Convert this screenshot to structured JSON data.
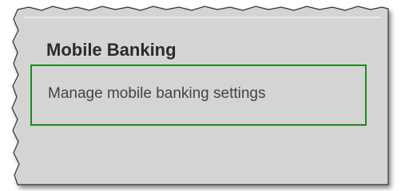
{
  "section": {
    "title": "Mobile Banking",
    "link_label": "Manage mobile banking settings"
  },
  "colors": {
    "panel_background": "#d4d4d4",
    "highlight_border": "#1e8a1e",
    "title_text": "#2b2b2b",
    "link_text": "#444444"
  }
}
